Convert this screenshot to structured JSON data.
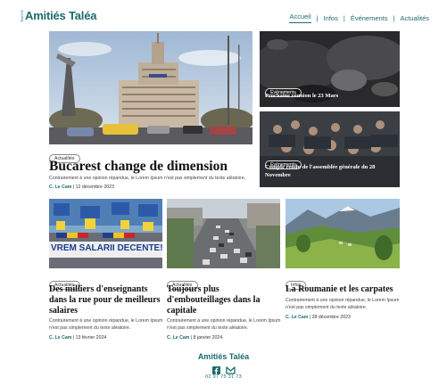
{
  "header": {
    "logo_prefix": "RADIO",
    "logo_text": "Amitiés Taléa",
    "nav": [
      "Accueil",
      "Infos",
      "Événements",
      "Actualités"
    ]
  },
  "hero": {
    "badge": "Actualités",
    "title": "Bucarest change de dimension",
    "excerpt": "Contrairement à une opinion répandue, le Lorem Ipsum n'est pas simplement du texte aléatoire.",
    "author": "C. Le Cam",
    "date": "| 12 décembre 2023"
  },
  "side_top": {
    "badge": "Événements",
    "title": "Prochaine réunion le 23 Mars"
  },
  "side_bottom": {
    "badge": "Événements",
    "title": "Compte rendu de l'assemblée générale du 28 Novembre"
  },
  "cards": [
    {
      "badge": "Actualités",
      "title": "Des milliers d'enseignants dans la rue pour de meilleurs salaires",
      "excerpt": "Contrairement à une opinion répandue, le Lorem Ipsum n'est pas simplement du texte aléatoire.",
      "author": "C. Le Cam",
      "date": "| 13 février 2024",
      "banner": "VREM SALARII DECENTE!"
    },
    {
      "badge": "Actualités",
      "title": "Toujours plus d'embouteillages dans la capitale",
      "excerpt": "Contrairement à une opinion répandue, le Lorem Ipsum n'est pas simplement du texte aléatoire.",
      "author": "C. Le Cam",
      "date": "| 8 janvier 2024"
    },
    {
      "badge": "Infos",
      "title": "La Roumanie et les carpates",
      "excerpt": "Contrairement à une opinion répandue, le Lorem Ipsum n'est pas simplement du texte aléatoire.",
      "author": "C. Le Cam",
      "date": "| 28 décembre 2023"
    }
  ],
  "footer": {
    "logo_text": "Amitiés Taléa",
    "phone": "02 97 75 31 73"
  },
  "colors": {
    "brand": "#1e6b6b"
  }
}
